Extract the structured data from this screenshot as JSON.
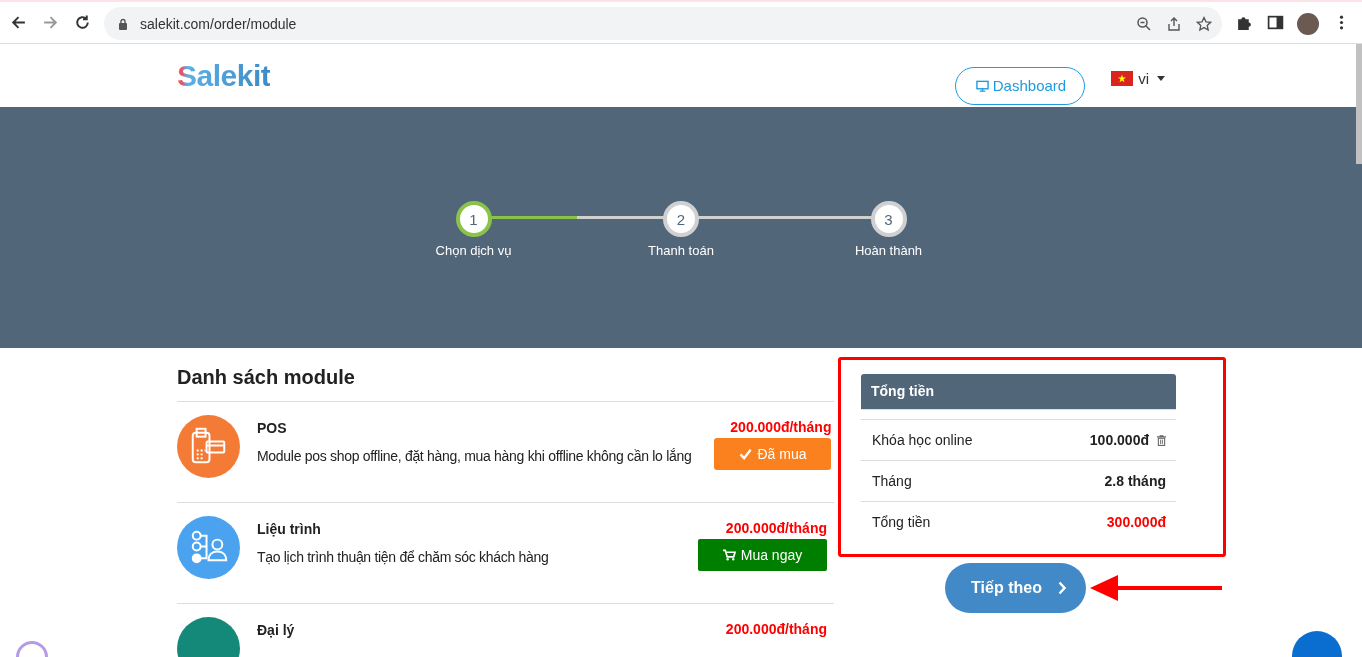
{
  "browser": {
    "url": "salekit.com/order/module"
  },
  "header": {
    "logo": "Salekit",
    "dashboard_button": "Dashboard",
    "language": "vi"
  },
  "steps": [
    {
      "number": "1",
      "label": "Chọn dịch vụ",
      "selected": true
    },
    {
      "number": "2",
      "label": "Thanh toán",
      "selected": false
    },
    {
      "number": "3",
      "label": "Hoàn thành",
      "selected": false
    }
  ],
  "progress": {
    "level": 0.25
  },
  "modules_title": "Danh sách module",
  "modules": [
    {
      "name": "POS",
      "description": "Module pos shop offline, đặt hàng, mua hàng khi offline không cần lo lắng",
      "price": "200.000đ/tháng",
      "button": "Đã mua",
      "purchased": true,
      "color": "#f47b36",
      "kind": "pos"
    },
    {
      "name": "Liệu trình",
      "description": "Tạo lịch trình thuận tiện để chăm sóc khách hàng",
      "price": "200.000đ/tháng",
      "button": "Mua ngay",
      "purchased": false,
      "color": "#4ba3ef",
      "kind": "schedule"
    },
    {
      "name": "Đại lý",
      "price": "200.000đ/tháng",
      "color": "#14897a",
      "kind": "agent"
    }
  ],
  "summary": {
    "title": "Tổng tiền",
    "rows": [
      {
        "label": "Khóa học online",
        "value": "100.000đ",
        "kind": "item"
      },
      {
        "label": "Tháng",
        "value": "2.8 tháng",
        "kind": "plain"
      },
      {
        "label": "Tổng tiền",
        "value": "300.000đ",
        "kind": "total"
      }
    ]
  },
  "next_button": "Tiếp theo"
}
